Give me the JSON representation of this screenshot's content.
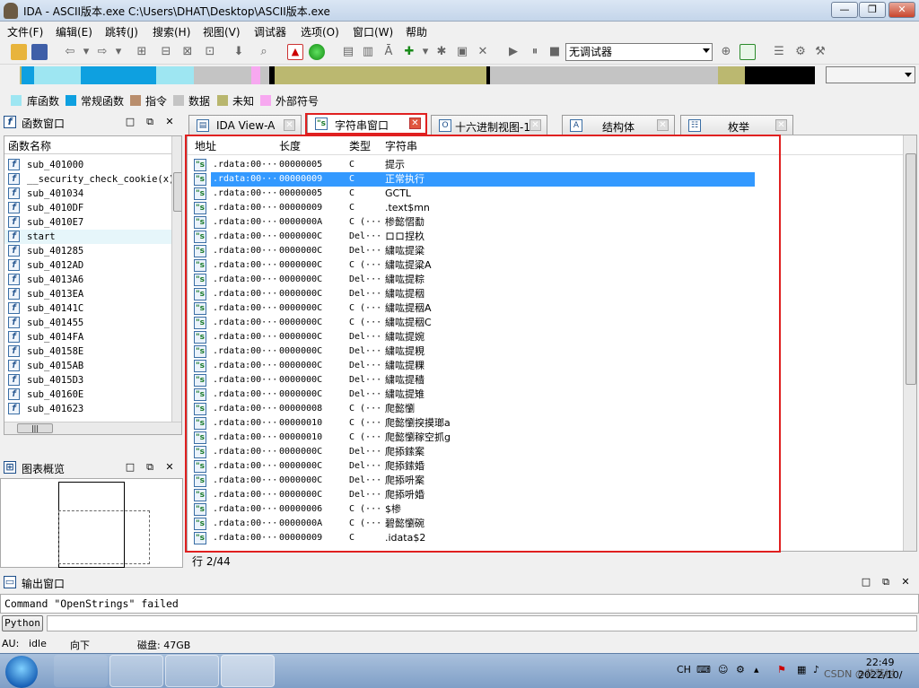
{
  "window": {
    "title": "IDA - ASCII版本.exe C:\\Users\\DHAT\\Desktop\\ASCII版本.exe",
    "minimize": "—",
    "restore": "❐",
    "close": "✕"
  },
  "menu": [
    "文件(F)",
    "编辑(E)",
    "跳转(J)",
    "搜索(H)",
    "视图(V)",
    "调试器",
    "选项(O)",
    "窗口(W)",
    "帮助"
  ],
  "toolbar": {
    "debugger_selected": "无调试器"
  },
  "legend": [
    {
      "label": "库函数",
      "color": "#9ee6f2"
    },
    {
      "label": "常规函数",
      "color": "#0ea0e0"
    },
    {
      "label": "指令",
      "color": "#b98e6d"
    },
    {
      "label": "数据",
      "color": "#c4c4c4"
    },
    {
      "label": "未知",
      "color": "#b8b66e"
    },
    {
      "label": "外部符号",
      "color": "#f7a8f0"
    }
  ],
  "functions_panel": {
    "title": "函数窗口",
    "column": "函数名称",
    "items": [
      "sub_401000",
      "__security_check_cookie(x)",
      "sub_401034",
      "sub_4010DF",
      "sub_4010E7",
      "start",
      "sub_401285",
      "sub_4012AD",
      "sub_4013A6",
      "sub_4013EA",
      "sub_40141C",
      "sub_401455",
      "sub_4014FA",
      "sub_40158E",
      "sub_4015AB",
      "sub_4015D3",
      "sub_40160E",
      "sub_401623"
    ],
    "hscroll_label": "|||"
  },
  "graph_panel": {
    "title": "图表概览"
  },
  "tabs": [
    {
      "label": "IDA View-A",
      "icon": "ida-view-icon"
    },
    {
      "label": "字符串窗口",
      "icon": "strings-icon"
    },
    {
      "label": "十六进制视图-1",
      "icon": "hex-icon"
    },
    {
      "label": "结构体",
      "icon": "struct-icon"
    },
    {
      "label": "枚举",
      "icon": "enum-icon"
    }
  ],
  "strings_view": {
    "columns": [
      "地址",
      "长度",
      "类型",
      "字符串"
    ],
    "rows": [
      [
        ".rdata:00···",
        "00000005",
        "C",
        "提示"
      ],
      [
        ".rdata:00···",
        "00000009",
        "C",
        "正常执行"
      ],
      [
        ".rdata:00···",
        "00000005",
        "C",
        "GCTL"
      ],
      [
        ".rdata:00···",
        "00000009",
        "C",
        ".text$mn"
      ],
      [
        ".rdata:00···",
        "0000000A",
        "C (···",
        "椮懿慴勫"
      ],
      [
        ".rdata:00···",
        "0000000C",
        "Del···",
        "ロロ捏杦"
      ],
      [
        ".rdata:00···",
        "0000000C",
        "Del···",
        "繍吰提粱"
      ],
      [
        ".rdata:00···",
        "0000000C",
        "C (···",
        "繍吰提粱A"
      ],
      [
        ".rdata:00···",
        "0000000C",
        "Del···",
        "繍吰提粽"
      ],
      [
        ".rdata:00···",
        "0000000C",
        "Del···",
        "繍吰提秵"
      ],
      [
        ".rdata:00···",
        "0000000C",
        "C (···",
        "繍吰提秵A"
      ],
      [
        ".rdata:00···",
        "0000000C",
        "C (···",
        "繍吰提秵C"
      ],
      [
        ".rdata:00···",
        "0000000C",
        "Del···",
        "繍吰提婉"
      ],
      [
        ".rdata:00···",
        "0000000C",
        "Del···",
        "繍吰提粯"
      ],
      [
        ".rdata:00···",
        "0000000C",
        "Del···",
        "繍吰提粿"
      ],
      [
        ".rdata:00···",
        "0000000C",
        "Del···",
        "繍吰提穑"
      ],
      [
        ".rdata:00···",
        "0000000C",
        "Del···",
        "繍吰提雉"
      ],
      [
        ".rdata:00···",
        "00000008",
        "C (···",
        "爬懿懰"
      ],
      [
        ".rdata:00···",
        "00000010",
        "C (···",
        "爬懿懰揬摸瑯a"
      ],
      [
        ".rdata:00···",
        "00000010",
        "C (···",
        "爬懿懰稼空抓g"
      ],
      [
        ".rdata:00···",
        "0000000C",
        "Del···",
        "爬掭鎍案"
      ],
      [
        ".rdata:00···",
        "0000000C",
        "Del···",
        "爬掭鎍婚"
      ],
      [
        ".rdata:00···",
        "0000000C",
        "Del···",
        "爬掭呏案"
      ],
      [
        ".rdata:00···",
        "0000000C",
        "Del···",
        "爬掭呏婚"
      ],
      [
        ".rdata:00···",
        "00000006",
        "C (···",
        "$椮"
      ],
      [
        ".rdata:00···",
        "0000000A",
        "C (···",
        "碧懿懰碗"
      ],
      [
        ".rdata:00···",
        "00000009",
        "C",
        ".idata$2"
      ]
    ],
    "selected_index": 1
  },
  "row_status": "行 2/44",
  "output_panel": {
    "title": "输出窗口",
    "text": "Command \"OpenStrings\" failed",
    "python_label": "Python"
  },
  "statusbar": {
    "au": "AU:",
    "state": "idle",
    "direction": "向下",
    "disk": "磁盘: 47GB"
  },
  "taskbar": {
    "lang": "CH",
    "time": "22:49",
    "date": "2022/10/",
    "watermark": "CSDN @花落树"
  }
}
